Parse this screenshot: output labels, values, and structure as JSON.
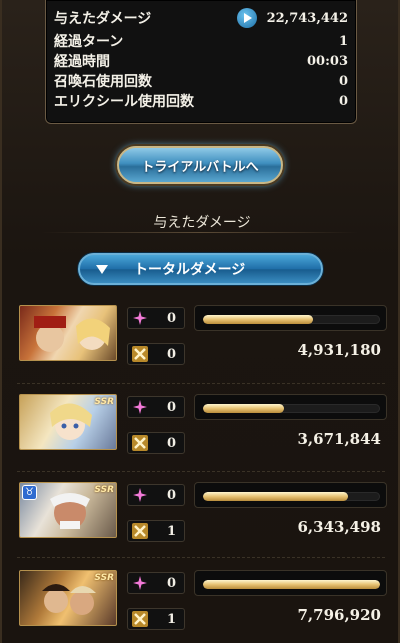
{
  "summary": {
    "damage_label": "与えたダメージ",
    "damage_value": "22,743,442",
    "turns_label": "経過ターン",
    "turns_value": "1",
    "time_label": "経過時間",
    "time_value": "00:03",
    "summon_label": "召喚石使用回数",
    "summon_value": "0",
    "elixir_label": "エリクシール使用回数",
    "elixir_value": "0"
  },
  "trial_button": "トライアルバトルへ",
  "section_title": "与えたダメージ",
  "total_dropdown": "トータルダメージ",
  "characters": [
    {
      "buff_count": "0",
      "ca_count": "0",
      "damage": "4,931,180",
      "bar_fraction": 0.62,
      "rarity": "",
      "element_badge": ""
    },
    {
      "buff_count": "0",
      "ca_count": "0",
      "damage": "3,671,844",
      "bar_fraction": 0.46,
      "rarity": "SSR",
      "element_badge": ""
    },
    {
      "buff_count": "0",
      "ca_count": "1",
      "damage": "6,343,498",
      "bar_fraction": 0.82,
      "rarity": "SSR",
      "element_badge": "♉"
    },
    {
      "buff_count": "0",
      "ca_count": "1",
      "damage": "7,796,920",
      "bar_fraction": 1.0,
      "rarity": "SSR",
      "element_badge": ""
    }
  ],
  "colors": {
    "bar_gold": "#e6c273",
    "button_blue": "#1f6ea8"
  },
  "icons": {
    "play": "play-icon",
    "buff": "sparkle-icon",
    "ca": "cross-swords-icon"
  }
}
